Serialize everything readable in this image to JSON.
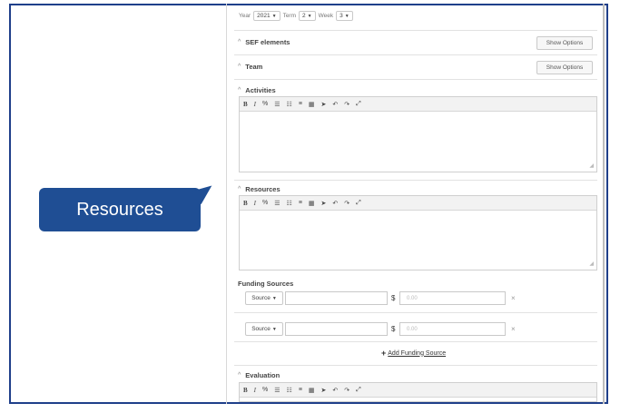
{
  "callout": {
    "label": "Resources"
  },
  "filters": {
    "year_label": "Year",
    "year_value": "2021",
    "term_label": "Term",
    "term_value": "2",
    "week_label": "Week",
    "week_value": "3"
  },
  "sections": {
    "sef": {
      "title": "SEF elements",
      "button": "Show Options"
    },
    "team": {
      "title": "Team",
      "button": "Show Options"
    },
    "activities": {
      "title": "Activities"
    },
    "resources": {
      "title": "Resources"
    },
    "evaluation": {
      "title": "Evaluation"
    }
  },
  "toolbar": {
    "bold": "B",
    "italic": "I",
    "link": "%",
    "list_ordered": "☰",
    "list_bullet": "☷",
    "align": "≡",
    "table": "▦",
    "cursor": "➤",
    "undo": "↶",
    "redo": "↷",
    "fullscreen": "⤢"
  },
  "funding": {
    "title": "Funding Sources",
    "rows": [
      {
        "source_label": "Source",
        "currency": "$",
        "amount_placeholder": "0.00",
        "remove": "×"
      },
      {
        "source_label": "Source",
        "currency": "$",
        "amount_placeholder": "0.00",
        "remove": "×"
      }
    ],
    "add_label": "Add Funding Source",
    "add_icon": "+"
  },
  "colors": {
    "callout": "#1f4e94",
    "frame_border": "#1f3f8a"
  }
}
